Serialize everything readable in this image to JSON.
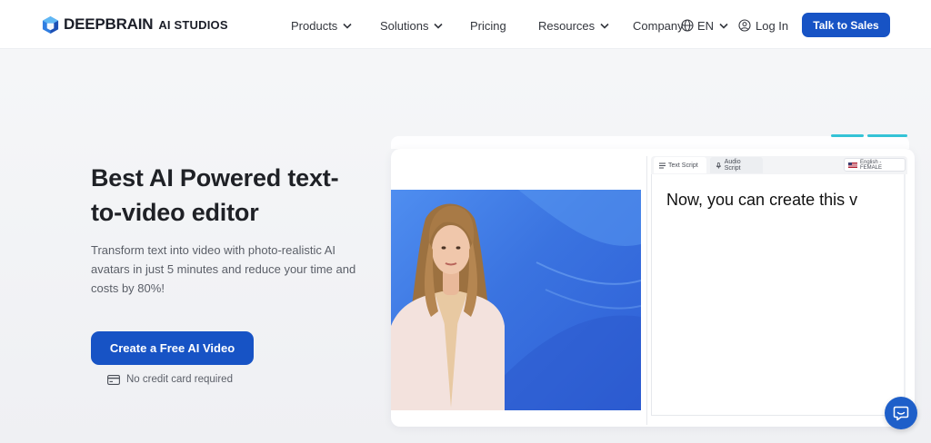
{
  "header": {
    "logo_brand": "DEEPBRAIN",
    "logo_sub": "AI STUDIOS",
    "nav": {
      "products": "Products",
      "solutions": "Solutions",
      "pricing": "Pricing",
      "resources": "Resources",
      "company": "Company"
    },
    "language": "EN",
    "login": "Log In",
    "talk_to_sales": "Talk to Sales"
  },
  "hero": {
    "title": "Best AI Powered text-to-video editor",
    "description": "Transform text into video with photo-realistic AI avatars in just 5 minutes and reduce your time and costs by 80%!",
    "cta": "Create a Free AI Video",
    "no_card": "No credit card required"
  },
  "editor": {
    "tab_text": "Text Script",
    "tab_audio": "Audio Script",
    "voice": "English - FEMALE",
    "script": "Now, you can create this v"
  },
  "colors": {
    "brand_blue": "#1753c5",
    "accent_teal": "#34c3d6",
    "video_bg": "#3a73e0"
  },
  "icons": {
    "logo": "deepbrain-cube-logo",
    "chevron": "chevron-down-icon",
    "globe": "globe-icon",
    "user": "user-icon",
    "card": "credit-card-icon",
    "chat": "chat-icon"
  }
}
